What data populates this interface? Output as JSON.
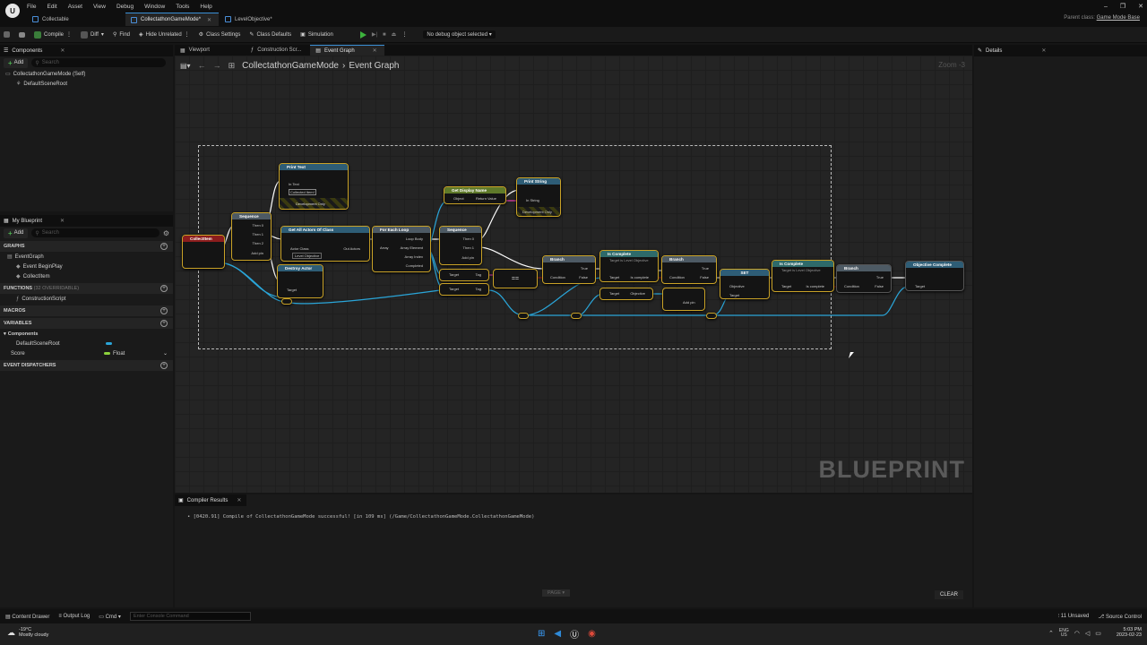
{
  "menu": [
    "File",
    "Edit",
    "Asset",
    "View",
    "Debug",
    "Window",
    "Tools",
    "Help"
  ],
  "doc_tabs": [
    {
      "label": "Collectable",
      "active": false
    },
    {
      "label": "CollectathonGameMode*",
      "active": true
    },
    {
      "label": "LevelObjective*",
      "active": false
    }
  ],
  "parent_class": {
    "prefix": "Parent class:",
    "value": "Game Mode Base"
  },
  "toolbar": {
    "compile": "Compile",
    "diff": "Diff",
    "find": "Find",
    "hide_unrelated": "Hide Unrelated",
    "class_settings": "Class Settings",
    "class_defaults": "Class Defaults",
    "simulation": "Simulation",
    "debug_object": "No debug object selected"
  },
  "components_panel": {
    "tab": "Components",
    "add": "Add",
    "search_placeholder": "Search",
    "items": [
      "CollectathonGameMode (Self)",
      "DefaultSceneRoot"
    ]
  },
  "editor_tabs": [
    "Viewport",
    "Construction Scr...",
    "Event Graph"
  ],
  "breadcrumb": {
    "root": "CollectathonGameMode",
    "sep": "›",
    "current": "Event Graph"
  },
  "zoom": "Zoom -3",
  "watermark": "BLUEPRINT",
  "my_blueprint": {
    "tab": "My Blueprint",
    "add": "Add",
    "search_placeholder": "Search",
    "graphs_label": "GRAPHS",
    "graphs": [
      "EventGraph",
      "Event BeginPlay",
      "CollectItem"
    ],
    "functions_label": "FUNCTIONS",
    "functions_count": "(32 OVERRIDABLE)",
    "functions": [
      "ConstructionScript"
    ],
    "macros_label": "MACROS",
    "variables_label": "VARIABLES",
    "variable_group": "Components",
    "variables": [
      {
        "name": "DefaultSceneRoot",
        "type": ""
      },
      {
        "name": "Score",
        "type": "Float"
      }
    ],
    "dispatchers_label": "EVENT DISPATCHERS"
  },
  "nodes": {
    "collect_item": "CollectItem",
    "sequence1": "Sequence",
    "print_text": "Print Text",
    "print_text_in": "In Text",
    "print_text_val": "Collected Item!",
    "dev_only": "Development Only",
    "get_all_actors": "Get All Actors Of Class",
    "actor_class": "Actor Class",
    "actor_class_val": "Level Objective",
    "out_actors": "Out Actors",
    "for_each": "For Each Loop",
    "loop_body": "Loop Body",
    "array": "Array",
    "array_element": "Array Element",
    "array_index": "Array Index",
    "completed": "Completed",
    "destroy_actor": "Destroy Actor",
    "target": "Target",
    "sequence2": "Sequence",
    "then0": "Then 0",
    "then1": "Then 1",
    "then2": "Then 2",
    "add_pin": "Add pin",
    "get_display_name": "Get Display Name",
    "object": "Object",
    "return_value": "Return Value",
    "print_string": "Print String",
    "in_string": "In String",
    "tag": "Tag",
    "equals": "==",
    "branch1": "Branch",
    "condition": "Condition",
    "true": "True",
    "false": "False",
    "is_complete1": "Is Complete",
    "is_complete_sub": "Target is Level Objective",
    "is_complete_out": "Is complete",
    "branch2": "Branch",
    "set": "SET",
    "objective": "Objective",
    "is_complete2": "Is Complete",
    "branch3": "Branch",
    "objective_complete": "Objective Complete"
  },
  "compiler": {
    "tab": "Compiler Results",
    "message": "• [0420.91] Compile of CollectathonGameMode successful! [in 109 ms] (/Game/CollectathonGameMode.CollectathonGameMode)",
    "page": "PAGE ▾",
    "clear": "CLEAR"
  },
  "details": {
    "tab": "Details"
  },
  "statusbar": {
    "content_drawer": "Content Drawer",
    "output_log": "Output Log",
    "cmd": "Cmd",
    "console_placeholder": "Enter Console Command",
    "unsaved": "11 Unsaved",
    "source_control": "Source Control"
  },
  "taskbar": {
    "temp": "-19°C",
    "weather": "Mostly cloudy",
    "lang1": "ENG",
    "lang2": "US",
    "time": "5:03 PM",
    "date": "2023-02-23"
  },
  "colors": {
    "accent": "#3a8fd6",
    "node_border": "#c9a227",
    "exec_wire": "#ffffff",
    "object_wire": "#2aa5d8",
    "bool_wire": "#9b1b1b"
  }
}
